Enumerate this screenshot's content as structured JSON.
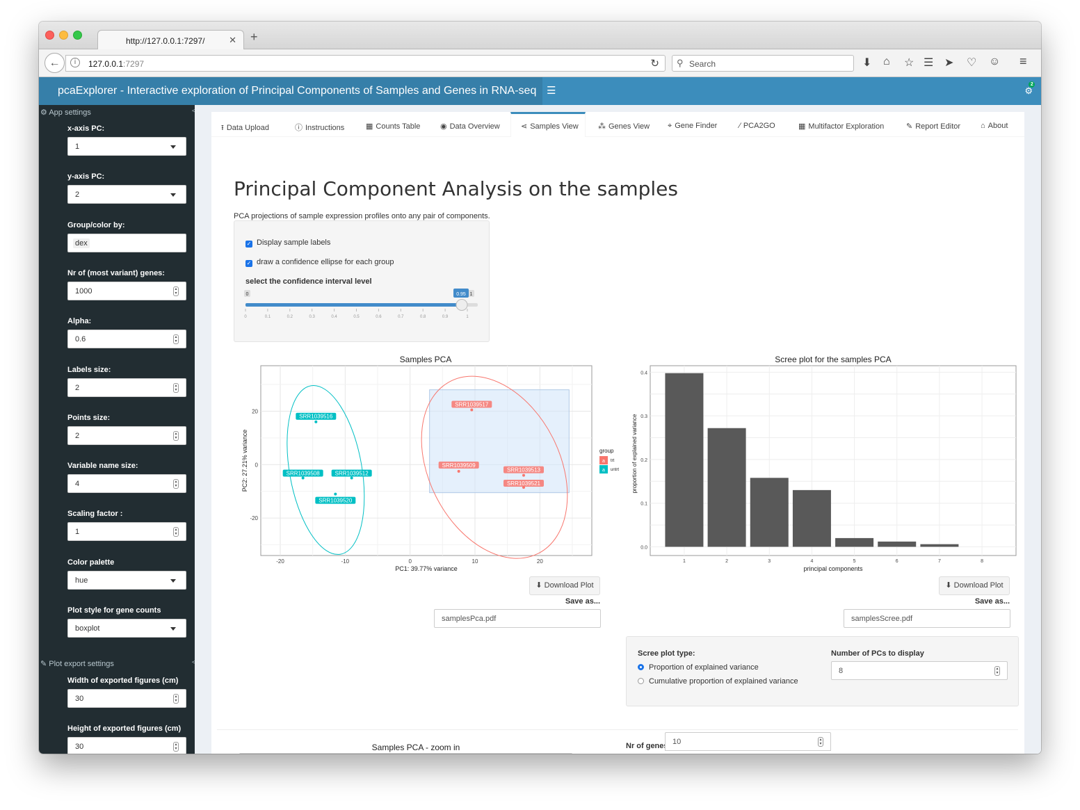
{
  "browser": {
    "tab_title": "http://127.0.0.1:7297/",
    "url_host": "127.0.0.1",
    "url_port": ":7297",
    "search_placeholder": "Search"
  },
  "app": {
    "title": "pcaExplorer - Interactive exploration of Principal Components of Samples and Genes in RNA-seq",
    "notification_count": "2"
  },
  "sidebar": {
    "app_settings_label": "App settings",
    "plot_export_label": "Plot export settings",
    "fields": [
      {
        "label": "x-axis PC:",
        "value": "1",
        "kind": "select"
      },
      {
        "label": "y-axis PC:",
        "value": "2",
        "kind": "select"
      },
      {
        "label": "Group/color by:",
        "value": "dex",
        "kind": "tag"
      },
      {
        "label": "Nr of (most variant) genes:",
        "value": "1000",
        "kind": "number"
      },
      {
        "label": "Alpha:",
        "value": "0.6",
        "kind": "number"
      },
      {
        "label": "Labels size:",
        "value": "2",
        "kind": "number"
      },
      {
        "label": "Points size:",
        "value": "2",
        "kind": "number"
      },
      {
        "label": "Variable name size:",
        "value": "4",
        "kind": "number"
      },
      {
        "label": "Scaling factor :",
        "value": "1",
        "kind": "number"
      },
      {
        "label": "Color palette",
        "value": "hue",
        "kind": "select"
      },
      {
        "label": "Plot style for gene counts",
        "value": "boxplot",
        "kind": "select"
      }
    ],
    "export_fields": [
      {
        "label": "Width of exported figures (cm)",
        "value": "30"
      },
      {
        "label": "Height of exported figures (cm)",
        "value": "30"
      }
    ]
  },
  "tabs": [
    {
      "label": "Data Upload",
      "icon": "upload-icon"
    },
    {
      "label": "Instructions",
      "icon": "info-icon"
    },
    {
      "label": "Counts Table",
      "icon": "table-icon"
    },
    {
      "label": "Data Overview",
      "icon": "eye-icon"
    },
    {
      "label": "Samples View",
      "icon": "share-icon",
      "active": true
    },
    {
      "label": "Genes View",
      "icon": "genes-icon"
    },
    {
      "label": "Gene Finder",
      "icon": "crosshairs-icon"
    },
    {
      "label": "PCA2GO",
      "icon": "wand-icon"
    },
    {
      "label": "Multifactor Exploration",
      "icon": "grid-icon"
    },
    {
      "label": "Report Editor",
      "icon": "pencil-icon"
    },
    {
      "label": "About",
      "icon": "institution-icon"
    }
  ],
  "page": {
    "title": "Principal Component Analysis on the samples",
    "subtitle": "PCA projections of sample expression profiles onto any pair of components.",
    "opt_labels": "Display sample labels",
    "opt_ellipse": "draw a confidence ellipse for each group",
    "slider_label": "select the confidence interval level",
    "slider_min": "0",
    "slider_max": "1",
    "slider_value": "0.95",
    "slider_ticks": [
      "0",
      "0.1",
      "0.2",
      "0.3",
      "0.4",
      "0.5",
      "0.6",
      "0.7",
      "0.8",
      "0.9",
      "1"
    ],
    "download_label": "Download Plot",
    "save_as_label": "Save as...",
    "pca_filename": "samplesPca.pdf",
    "scree_filename": "samplesScree.pdf",
    "scree_type_label": "Scree plot type:",
    "scree_opt1": "Proportion of explained variance",
    "scree_opt2": "Cumulative proportion of explained variance",
    "npcs_label": "Number of PCs to display",
    "npcs_value": "8",
    "zoom_title": "Samples PCA - zoom in",
    "ngenes_label": "Nr of genes to display (top & bottom)",
    "ngenes_value": "10"
  },
  "colors": {
    "accent": "#3c8dbc",
    "trt": "#f8766d",
    "untrt": "#00bfc4",
    "bar": "#595959"
  },
  "chart_data": [
    {
      "type": "scatter",
      "title": "Samples PCA",
      "xlabel": "PC1: 39.77% variance",
      "ylabel": "PC2: 27.21% variance",
      "xticks": [
        "-20",
        "-10",
        "0",
        "10",
        "20"
      ],
      "yticks": [
        "20",
        "0",
        "-20"
      ],
      "xlim": [
        -23,
        28
      ],
      "ylim": [
        -34,
        37
      ],
      "legend_title": "group",
      "series": [
        {
          "name": "trt",
          "points": [
            {
              "label": "SRR1039517",
              "x": 9.5,
              "y": 20.5
            },
            {
              "label": "SRR1039509",
              "x": 7.5,
              "y": -2.5
            },
            {
              "label": "SRR1039513",
              "x": 17.5,
              "y": -4
            },
            {
              "label": "SRR1039521",
              "x": 17.5,
              "y": -8.5
            }
          ]
        },
        {
          "name": "untrt",
          "points": [
            {
              "label": "SRR1039516",
              "x": -14.5,
              "y": 16
            },
            {
              "label": "SRR1039508",
              "x": -16.5,
              "y": -5
            },
            {
              "label": "SRR1039512",
              "x": -9,
              "y": -5
            },
            {
              "label": "SRR1039520",
              "x": -11.5,
              "y": -11
            }
          ]
        }
      ]
    },
    {
      "type": "bar",
      "title": "Scree plot for the samples PCA",
      "xlabel": "principal components",
      "ylabel": "proportion of explained variance",
      "categories": [
        "1",
        "2",
        "3",
        "4",
        "5",
        "6",
        "7",
        "8"
      ],
      "values": [
        0.398,
        0.272,
        0.158,
        0.13,
        0.02,
        0.012,
        0.006,
        0
      ],
      "yticks": [
        "0.0",
        "0.1",
        "0.2",
        "0.3",
        "0.4"
      ],
      "ylim": [
        -0.02,
        0.415
      ]
    }
  ]
}
